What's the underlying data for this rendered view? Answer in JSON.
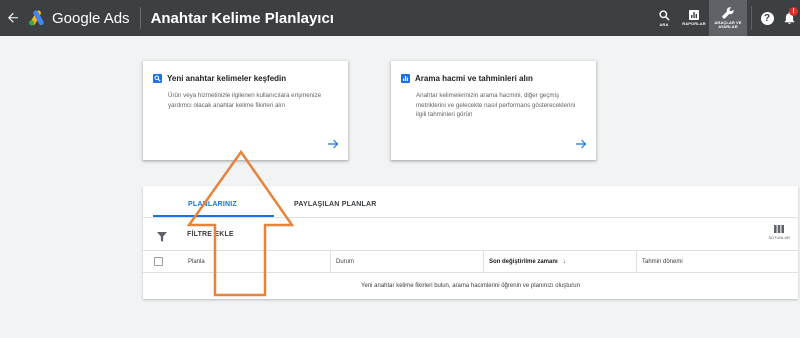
{
  "header": {
    "brand": "Google Ads",
    "page_title": "Anahtar Kelime Planlayıcı",
    "actions": [
      {
        "label": "ARA",
        "icon": "search-icon"
      },
      {
        "label": "RAPORLAR",
        "icon": "reports-icon"
      },
      {
        "label": "ARAÇLAR VE AYARLAR",
        "icon": "wrench-icon"
      }
    ],
    "notification_badge": "!"
  },
  "cards": [
    {
      "title": "Yeni anahtar kelimeler keşfedin",
      "description": "Ürün veya hizmetinizle ilgilenen kullanıcılara erişmenize yardımcı olacak anahtar kelime fikirleri alın",
      "icon": "search-icon"
    },
    {
      "title": "Arama hacmi ve tahminleri alın",
      "description": "Anahtar kelimelerinizin arama hacmini, diğer geçmiş metriklerini ve gelecekte nasıl performans göstereceklerini ilgili tahminleri görün",
      "icon": "bar-chart-icon"
    }
  ],
  "plans": {
    "tabs": [
      "PLANLARINIZ",
      "PAYLAŞILAN PLANLAR"
    ],
    "active_tab": "PLANLARINIZ",
    "filter_label": "FİLTRE EKLE",
    "columns_label": "SÜTUNLAR",
    "table_headers": [
      "Planla",
      "Durum",
      "Son değiştirilme zamanı",
      "Tahmin dönemi"
    ],
    "sort_indicator": "↓",
    "empty_message": "Yeni anahtar kelime fikirleri bulun, arama hacimlerini öğrenin ve planınızı oluşturun"
  },
  "colors": {
    "topbar": "#3c4043",
    "accent": "#1a73e8",
    "highlight_arrow": "#e8833a"
  }
}
